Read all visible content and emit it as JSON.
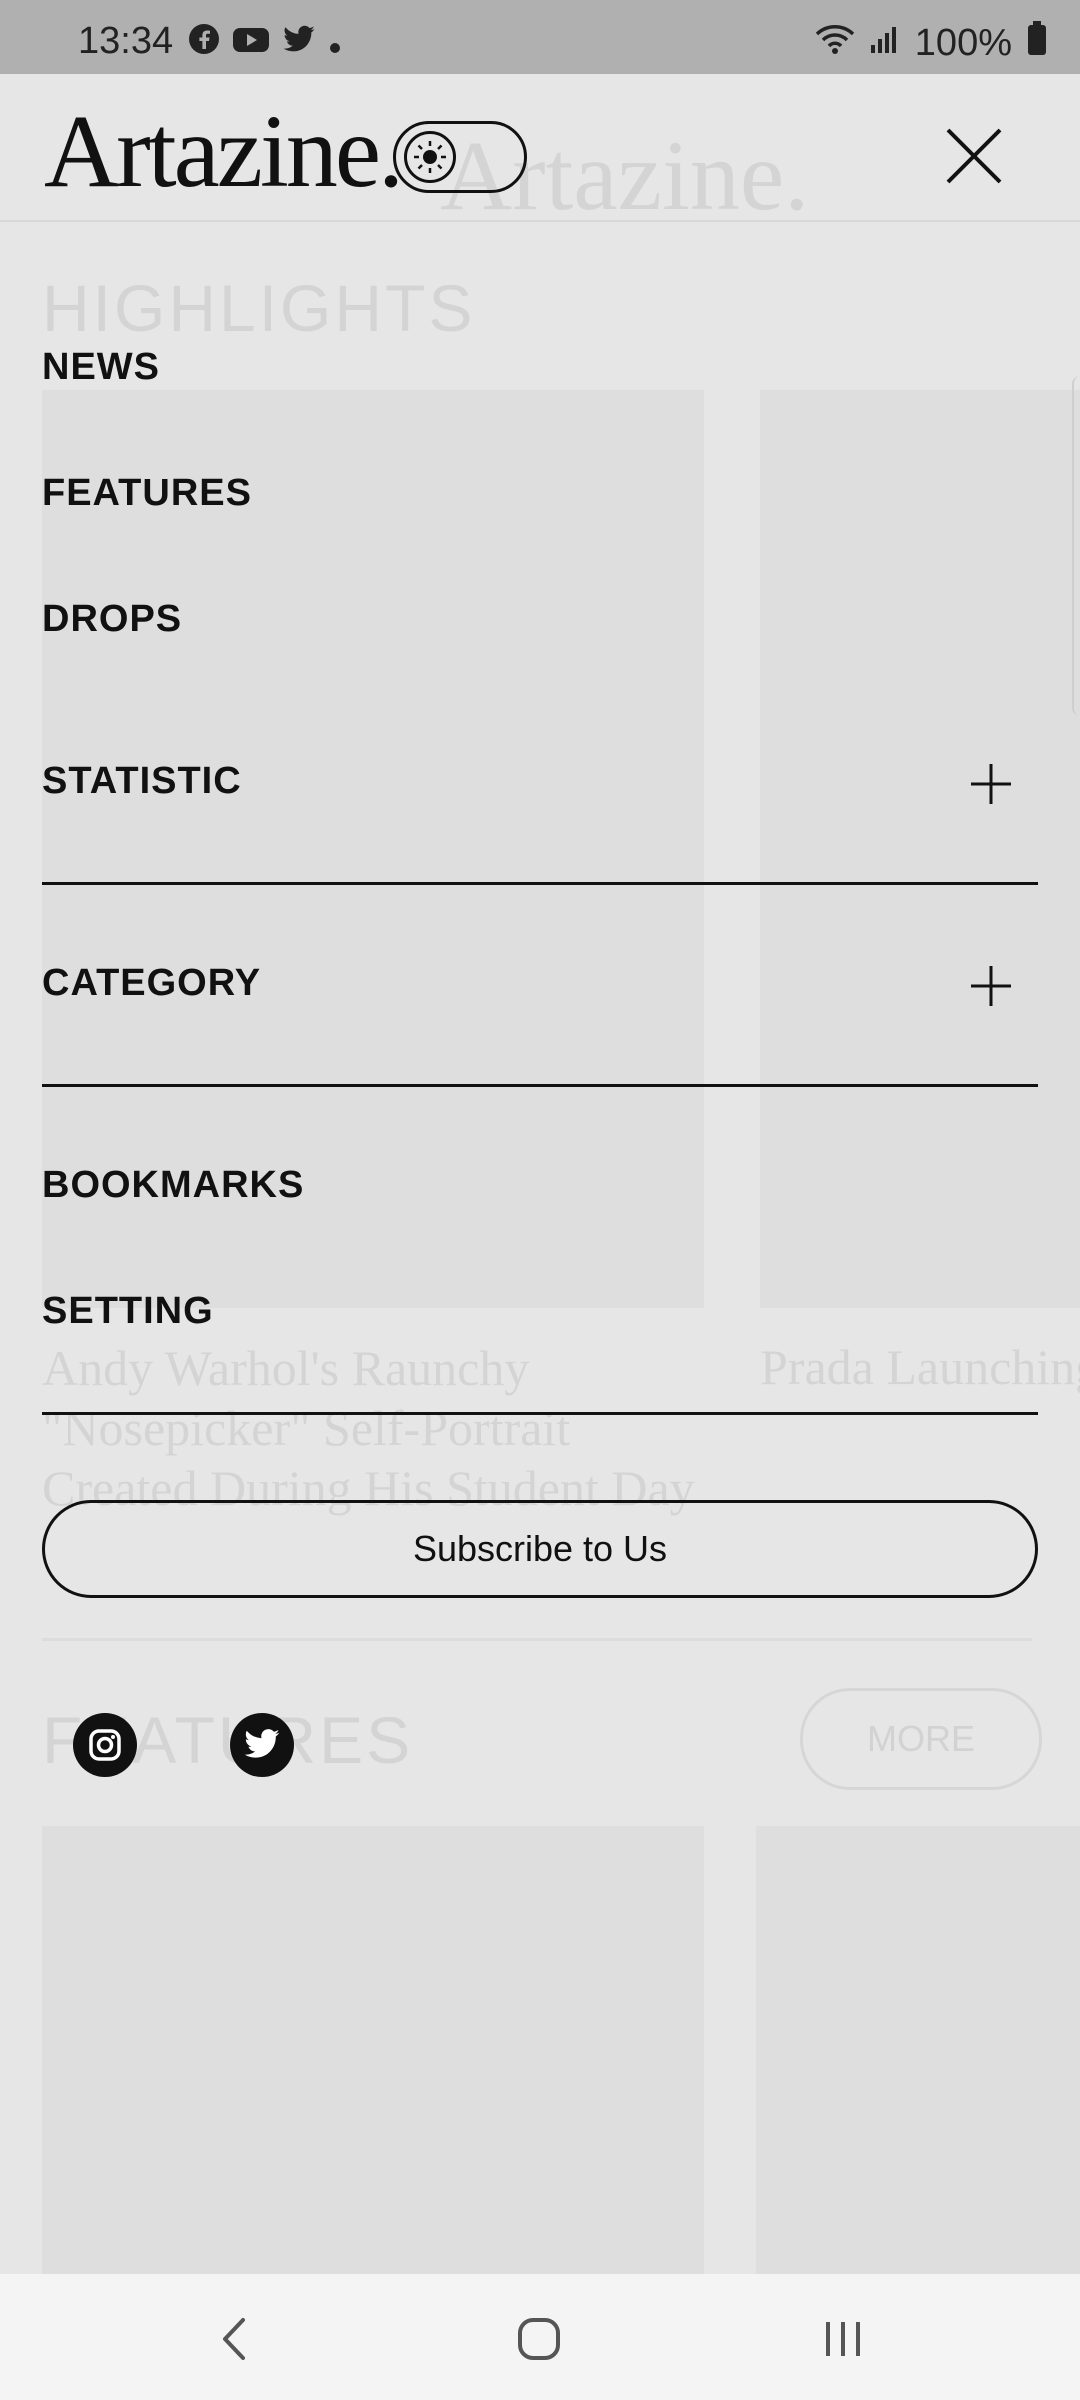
{
  "status_bar": {
    "time": "13:34",
    "notification_icons": [
      "facebook-icon",
      "youtube-icon",
      "twitter-icon",
      "dot-icon"
    ],
    "battery": "100%",
    "system_icons": [
      "wifi-icon",
      "signal-icon",
      "battery-icon"
    ]
  },
  "header": {
    "logo": "Artazine.",
    "theme_toggle_icon": "sun-icon",
    "close_icon": "close-icon"
  },
  "background_page": {
    "section1_title": "HIGHLIGHTS",
    "article1_title": "Andy Warhol's Raunchy \"Nosepicker\" Self-Portrait Created During His Student Day",
    "article2_title": "Prada Launching NFTs For Its Ori",
    "section2_title": "FEATURES",
    "more_label": "MORE"
  },
  "menu": {
    "items": [
      {
        "label": "NEWS"
      },
      {
        "label": "FEATURES"
      },
      {
        "label": "DROPS"
      },
      {
        "label": "STATISTIC",
        "expandable": true
      },
      {
        "label": "CATEGORY",
        "expandable": true
      },
      {
        "label": "BOOKMARKS"
      },
      {
        "label": "SETTING"
      }
    ],
    "subscribe_label": "Subscribe to Us",
    "social": [
      "instagram-icon",
      "twitter-icon"
    ]
  },
  "nav_bar": [
    "back-icon",
    "home-icon",
    "recents-icon"
  ]
}
